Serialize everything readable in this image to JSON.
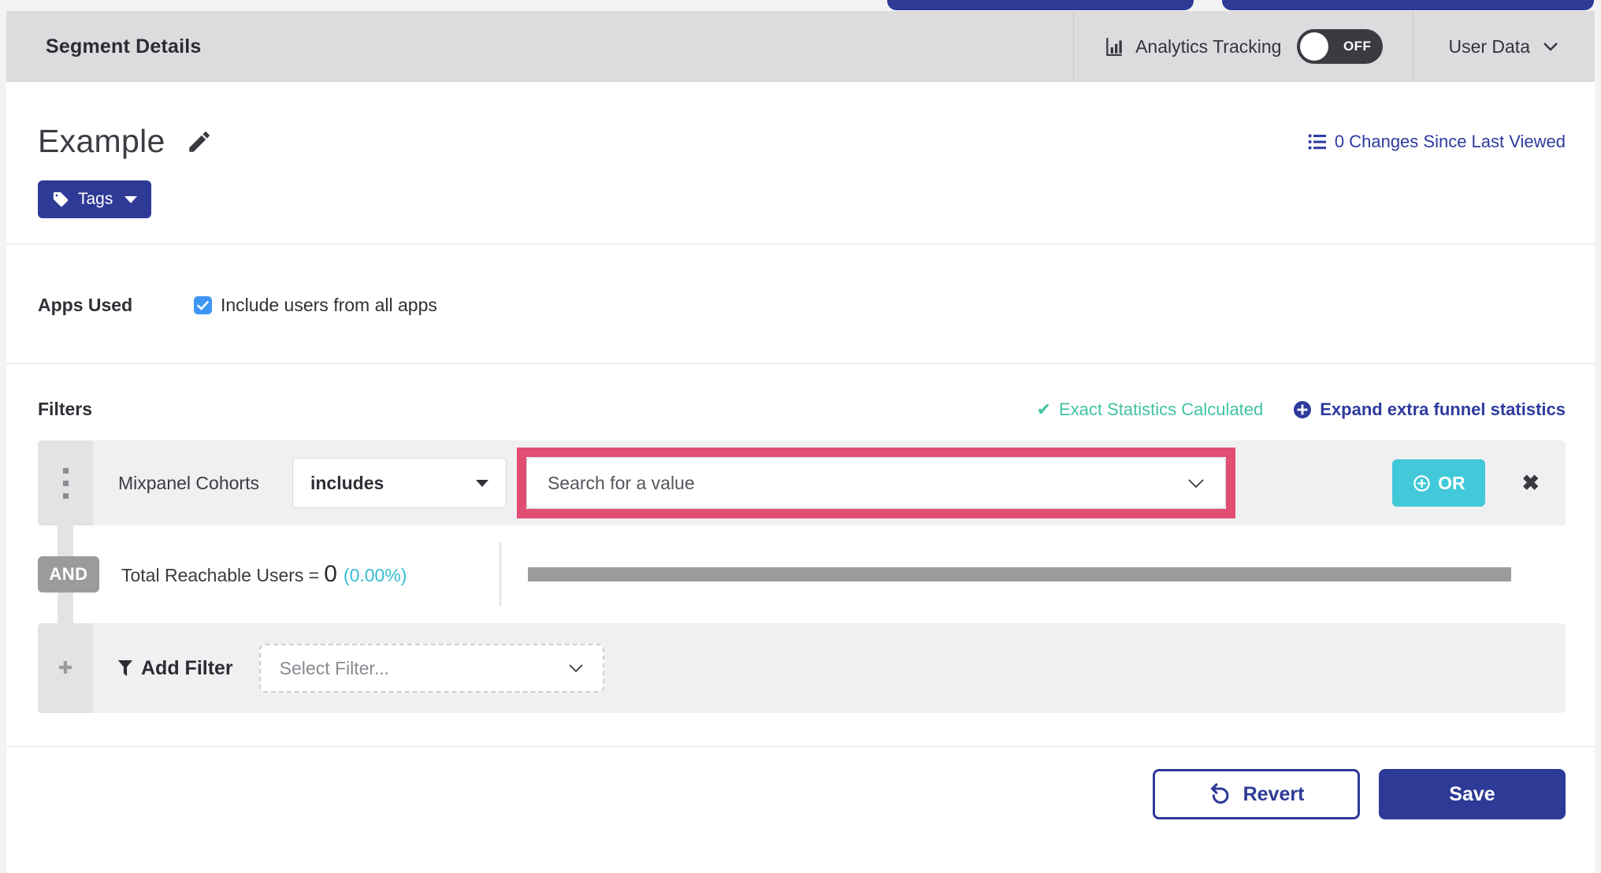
{
  "header": {
    "title": "Segment Details",
    "analytics_label": "Analytics Tracking",
    "toggle_state": "OFF",
    "user_data_label": "User Data"
  },
  "segment": {
    "name": "Example",
    "changes_link": "0 Changes Since Last Viewed",
    "tags_button": "Tags"
  },
  "apps": {
    "label": "Apps Used",
    "checkbox_label": "Include users from all apps",
    "checked": true
  },
  "filters": {
    "heading": "Filters",
    "exact_stats": "Exact Statistics Calculated",
    "expand_link": "Expand extra funnel statistics",
    "row": {
      "name": "Mixpanel Cohorts",
      "operator": "includes",
      "value_placeholder": "Search for a value",
      "or_button": "OR"
    },
    "and_label": "AND",
    "reachable": {
      "text": "Total Reachable Users =",
      "count": "0",
      "percent": "(0.00%)",
      "progress_value": 0
    },
    "add_filter": {
      "label": "Add Filter",
      "placeholder": "Select Filter..."
    }
  },
  "footer": {
    "revert": "Revert",
    "save": "Save"
  },
  "icons": {
    "close": "✖",
    "check": "✔",
    "plus": "✚"
  },
  "colors": {
    "indigo": "#2d3a96",
    "teal_or": "#41c9d9",
    "green_stats": "#40c3a3",
    "cyan_percent": "#34bed2",
    "pink_highlight": "#e14d73",
    "checkbox_blue": "#3f97f5",
    "header_gray": "#dcdcdf",
    "bar_gray": "#9b9b9b"
  }
}
